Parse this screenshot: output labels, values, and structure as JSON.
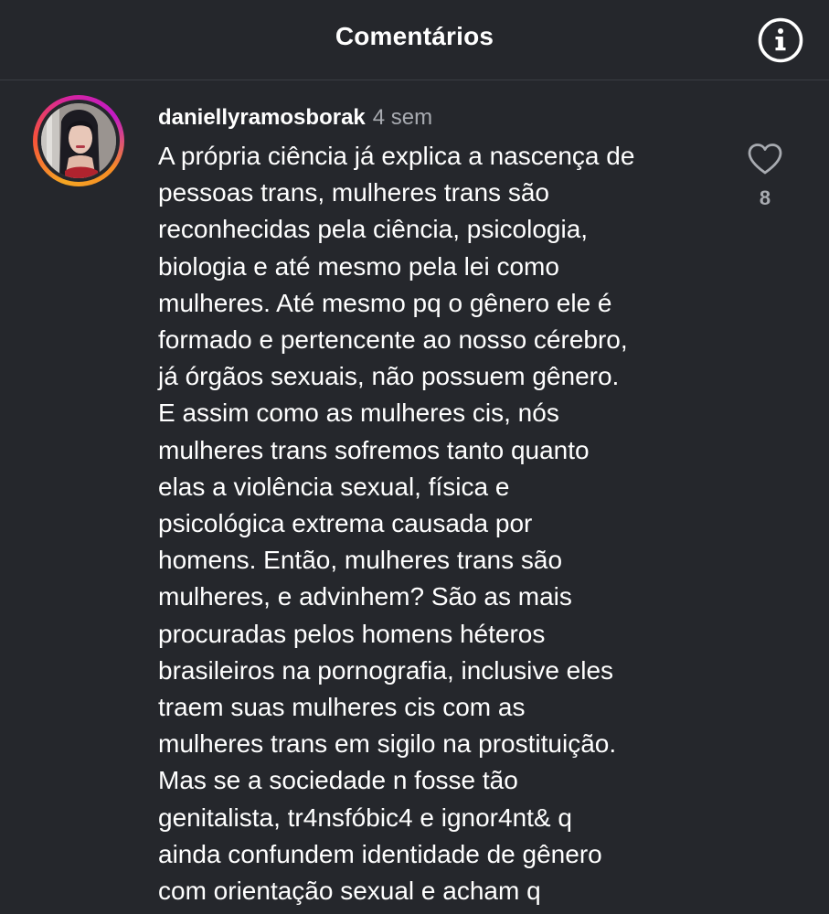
{
  "header": {
    "title": "Comentários"
  },
  "comment": {
    "username": "daniellyramosborak",
    "timestamp": "4 sem",
    "likes": "8",
    "lines": [
      "A própria ciência já explica a nascença de",
      "pessoas trans, mulheres trans são",
      "reconhecidas pela ciência, psicologia,",
      "biologia e até mesmo pela lei como",
      "mulheres. Até mesmo pq o gênero ele é",
      "formado e pertencente ao nosso cérebro,",
      "já órgãos sexuais, não possuem gênero.",
      "E assim como as mulheres cis, nós",
      "mulheres trans sofremos tanto quanto",
      "elas a violência sexual, física e",
      "psicológica extrema causada por",
      "homens. Então, mulheres trans são",
      "mulheres, e advinhem? São as mais",
      "procuradas pelos homens héteros",
      "brasileiros na pornografia, inclusive eles",
      "traem suas mulheres cis com as",
      "mulheres trans em sigilo na prostituição.",
      "Mas se a sociedade n fosse tão",
      "genitalista, tr4nsfóbic4 e ignor4nt& q",
      "ainda confundem identidade de gênero",
      "com orientação sexual e acham q"
    ]
  },
  "icons": {
    "info": "info-icon",
    "like": "heart-outline-icon"
  },
  "colors": {
    "background": "#25272c",
    "text": "#ffffff",
    "secondary_text": "#a8abb1",
    "story_ring": [
      "#f5a623",
      "#d6249f"
    ]
  }
}
